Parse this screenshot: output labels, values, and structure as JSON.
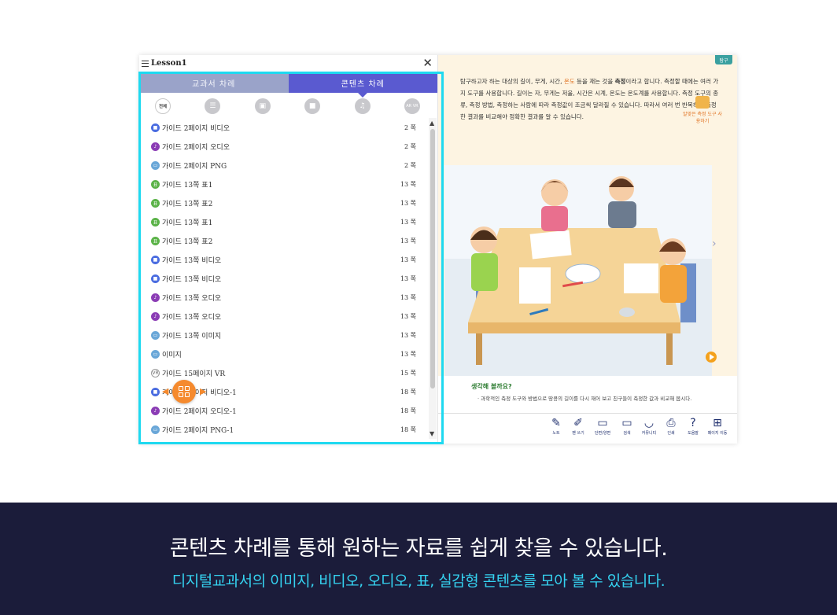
{
  "panel": {
    "title": "Lesson1",
    "tabs": [
      {
        "label": "교과서 차례",
        "active": false
      },
      {
        "label": "콘텐츠 차례",
        "active": true
      }
    ],
    "filters": [
      {
        "icon": "all-icon",
        "label": "전체"
      },
      {
        "icon": "list-icon"
      },
      {
        "icon": "image-icon"
      },
      {
        "icon": "video-icon"
      },
      {
        "icon": "audio-icon"
      },
      {
        "icon": "ar-vr-icon",
        "label": "AR VR"
      }
    ],
    "items": [
      {
        "type": "video",
        "title": "가이드 2페이지 비디오",
        "page": "2 쪽"
      },
      {
        "type": "audio",
        "title": "가이드 2페이지 오디오",
        "page": "2 쪽"
      },
      {
        "type": "image",
        "title": "가이드 2페이지 PNG",
        "page": "2 쪽"
      },
      {
        "type": "table",
        "title": "가이드 13쪽 표1",
        "page": "13 쪽"
      },
      {
        "type": "table",
        "title": "가이드 13쪽 표2",
        "page": "13 쪽"
      },
      {
        "type": "table",
        "title": "가이드 13쪽 표1",
        "page": "13 쪽"
      },
      {
        "type": "table",
        "title": "가이드 13쪽 표2",
        "page": "13 쪽"
      },
      {
        "type": "video",
        "title": "가이드 13쪽 비디오",
        "page": "13 쪽"
      },
      {
        "type": "video",
        "title": "가이드 13쪽 비디오",
        "page": "13 쪽"
      },
      {
        "type": "audio",
        "title": "가이드 13쪽 오디오",
        "page": "13 쪽"
      },
      {
        "type": "audio",
        "title": "가이드 13쪽 오디오",
        "page": "13 쪽"
      },
      {
        "type": "image",
        "title": "가이드 13쪽 이미지",
        "page": "13 쪽"
      },
      {
        "type": "image",
        "title": "이미지",
        "page": "13 쪽"
      },
      {
        "type": "vr",
        "title": "가이드 15페이지 VR",
        "page": "15 쪽"
      },
      {
        "type": "video",
        "title": "가이드 2페이지 비디오-1",
        "page": "18 쪽"
      },
      {
        "type": "audio",
        "title": "가이드 2페이지 오디오-1",
        "page": "18 쪽"
      },
      {
        "type": "image",
        "title": "가이드 2페이지 PNG-1",
        "page": "18 쪽"
      }
    ]
  },
  "book": {
    "badge": "탐구",
    "paragraph": {
      "p1": "탐구하고자 하는 대상의 길이, 무게, 시간, ",
      "hl": "온도",
      "p2": " 등을 재는 것을 ",
      "bold": "측정",
      "p3": "이라고 합니다. 측정할 때에는 여러 가지 도구를 사용합니다. 길이는 자, 무게는 저울, 시간은 시계, 온도는 온도계를 사용합니다. 측정 도구의 종류, 측정 방법, 측정하는 사람에 따라 측정값이 조금씩 달라질 수 있습니다. 따라서 여러 번 반복하여 측정한 결과를 비교해야 정확한 결과를 알 수 있습니다."
    },
    "side_tool": "알맞은 측정 도구 사용하기",
    "think_title": "생각해 볼까요?",
    "think_text": "· 과학적인 측정 도구와 방법으로 땅콩의 길이를 다시 재어 보고 친구들이 측정한 값과 비교해 봅시다.",
    "toolbar": [
      {
        "icon": "note-icon",
        "glyph": "✎",
        "label": "노트"
      },
      {
        "icon": "pen-icon",
        "glyph": "✐",
        "label": "펜 쓰기"
      },
      {
        "icon": "single-page-icon",
        "glyph": "▭",
        "label": "단면/양면"
      },
      {
        "icon": "search-icon",
        "glyph": "▭",
        "label": "검색"
      },
      {
        "icon": "community-icon",
        "glyph": "◡",
        "label": "커뮤니티"
      },
      {
        "icon": "print-icon",
        "glyph": "⎙",
        "label": "인쇄"
      },
      {
        "icon": "help-icon",
        "glyph": "?",
        "label": "도움말"
      },
      {
        "icon": "page-move-icon",
        "glyph": "⊞",
        "label": "페이지 이동"
      }
    ]
  },
  "caption": {
    "main": "콘텐츠 차례를 통해 원하는 자료를 쉽게 찾을 수 있습니다.",
    "sub": "디지털교과서의 이미지, 비디오, 오디오, 표, 실감형 콘텐츠를 모아 볼 수 있습니다."
  },
  "colors": {
    "highlight": "#1ed9f0",
    "tab_active": "#5a5ad0",
    "tab_inactive": "#9aa3c9",
    "caption_bg": "#1b1c3a",
    "caption_sub": "#35d2f0"
  }
}
